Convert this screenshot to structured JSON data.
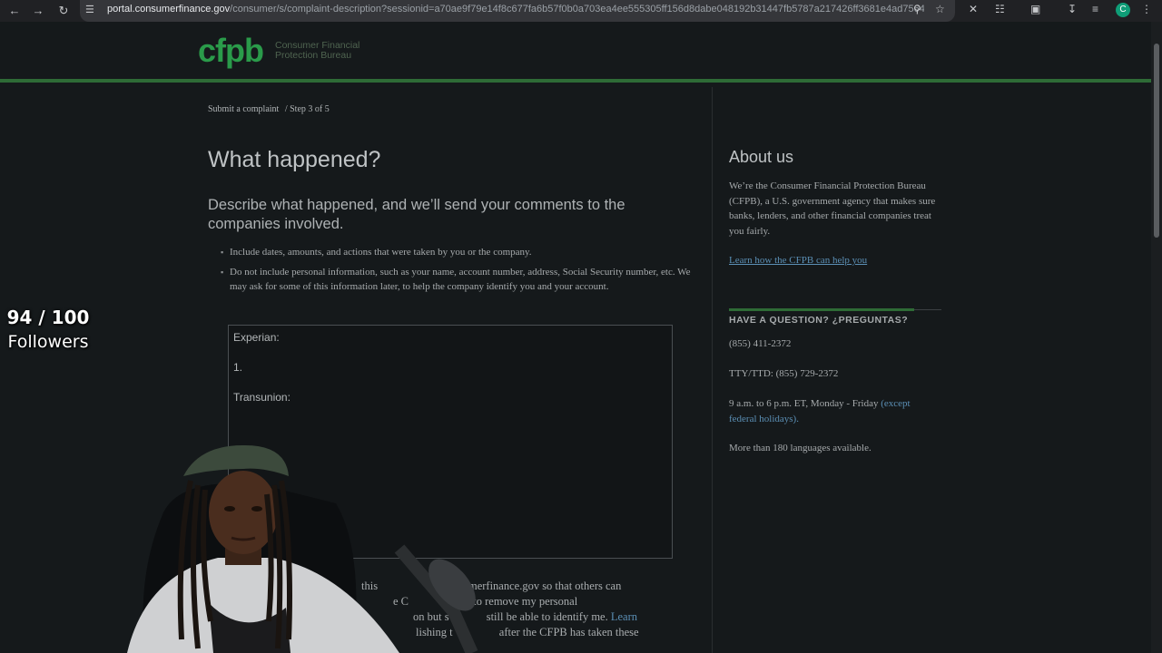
{
  "browser": {
    "url_host": "portal.consumerfinance.gov",
    "url_rest": "/consumer/s/complaint-description?sessionid=a70ae9f79e14f8c677fa6b57f0b0a703ea4ee555305ff156d8dabe048192b31447fb5787a217426ff3681e4ad75645d...",
    "profile_initial": "C"
  },
  "header": {
    "logo_mark": "cfpb",
    "logo_line1": "Consumer Financial",
    "logo_line2": "Protection Bureau"
  },
  "breadcrumb": {
    "link": "Submit a complaint",
    "step": "/ Step 3 of 5"
  },
  "main": {
    "title": "What happened?",
    "subtitle": "Describe what happened, and we’ll send your comments to the companies involved.",
    "bullets": [
      "Include dates, amounts, and actions that were taken by you or the company.",
      "Do not include personal information, such as your name, account number, address, Social Security number, etc. We may ask for some of this information later, to help the company identify you and your account."
    ],
    "description_lines": [
      "Experian:",
      "1.",
      "Transunion:"
    ],
    "share_line1": "this",
    "share_line1b": "on consumerfinance.gov so that others can",
    "share_line2a": "e C",
    "share_line2b": "steps to remove my personal",
    "share_line3a": "on but s",
    "share_line3b": "still be able to identify me.",
    "share_link": "Learn",
    "share_line4a": "lishing t",
    "share_line4b": "after the CFPB has taken these"
  },
  "sidebar": {
    "about_title": "About us",
    "about_body": "We’re the Consumer Financial Protection Bureau (CFPB), a U.S. government agency that makes sure banks, lenders, and other financial companies treat you fairly.",
    "about_link": "Learn how the CFPB can help you",
    "question_title": "HAVE A QUESTION? ¿PREGUNTAS?",
    "phone": "(855) 411-2372",
    "tty": "TTY/TTD: (855) 729-2372",
    "hours": "9 a.m. to 6 p.m. ET, Monday - Friday",
    "hours_link": "(except federal holidays).",
    "languages": "More than 180 languages available."
  },
  "overlay": {
    "followers_count": "94 / 100",
    "followers_label": "Followers"
  },
  "colors": {
    "brand_green": "#2a9b4a",
    "link_blue": "#5b8fb5",
    "page_bg": "#15191b"
  }
}
